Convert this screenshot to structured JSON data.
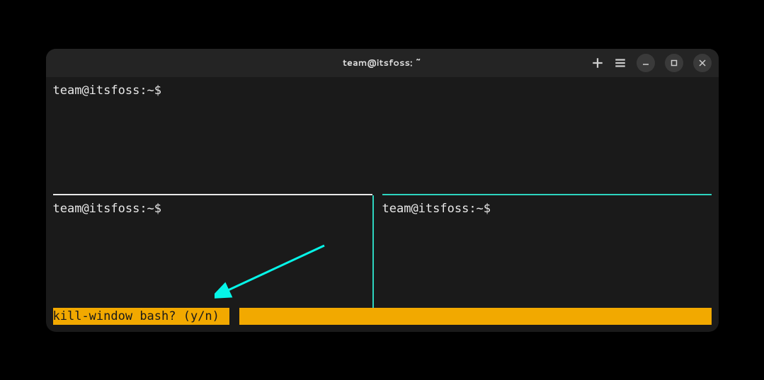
{
  "window": {
    "title": "team@itsfoss: ~"
  },
  "panes": {
    "top": {
      "prompt": "team@itsfoss:~$"
    },
    "bottom_left": {
      "prompt": "team@itsfoss:~$"
    },
    "bottom_right": {
      "prompt": "team@itsfoss:~$"
    }
  },
  "status_bar": {
    "prompt": "kill-window bash? (y/n) "
  },
  "colors": {
    "accent_teal": "#2dd4bf",
    "status_yellow": "#f2a900",
    "divider_white": "#e8e8e8"
  }
}
